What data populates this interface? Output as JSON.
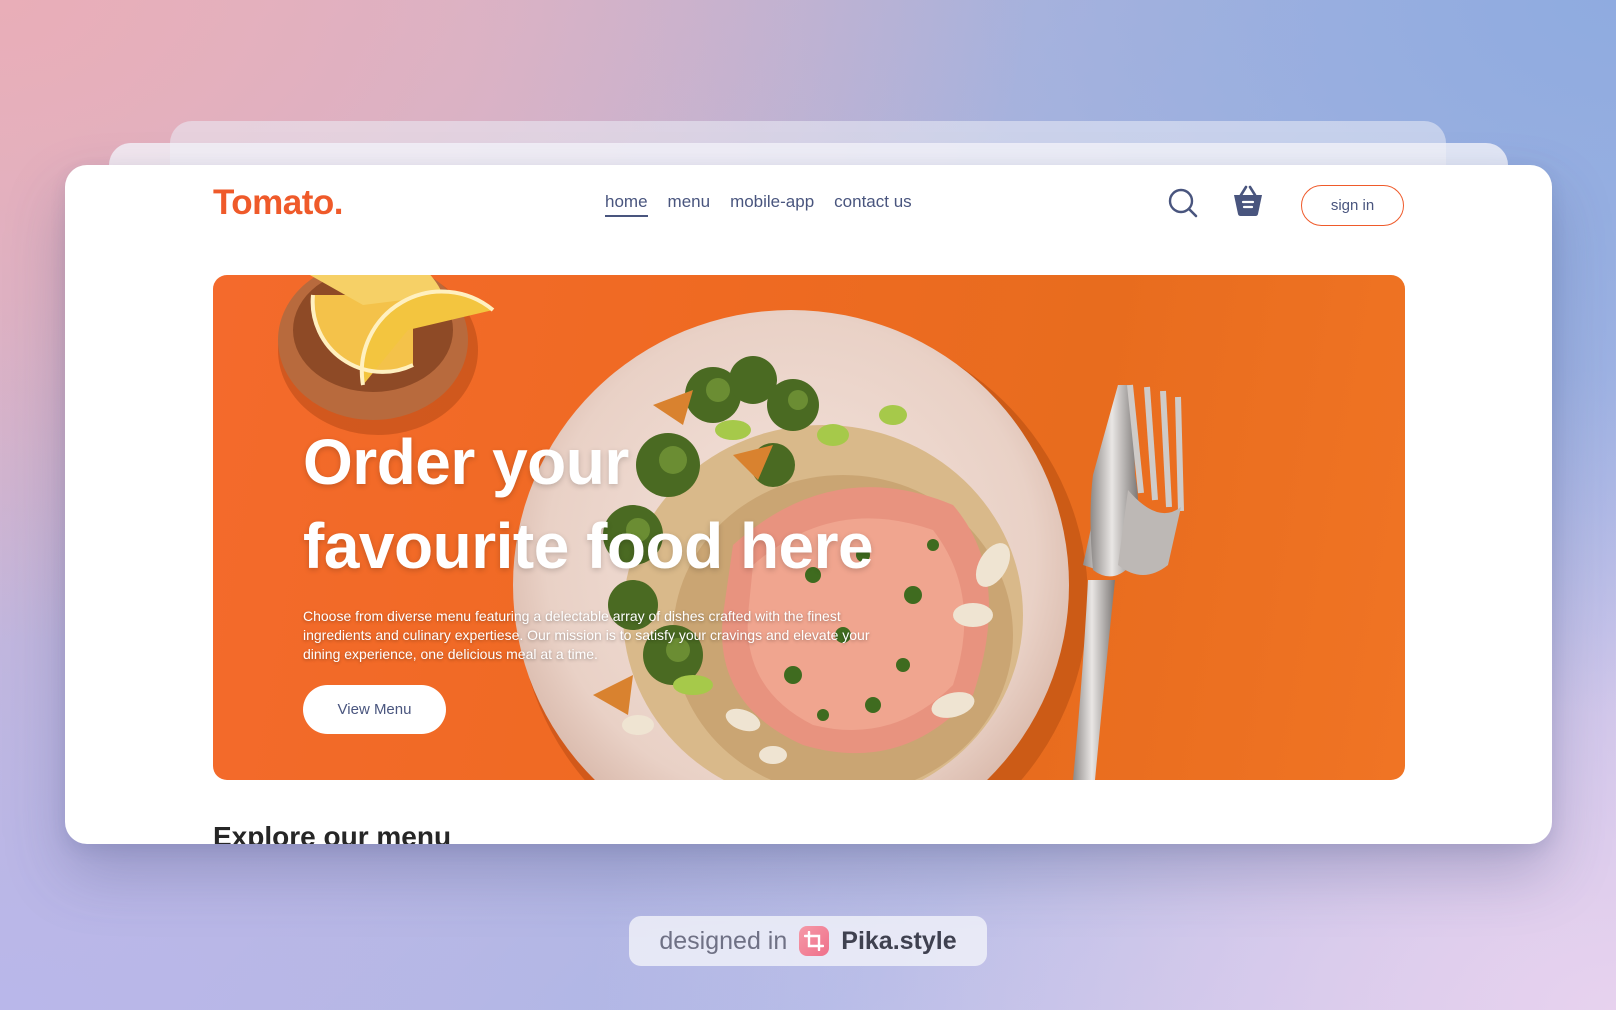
{
  "brand": {
    "logo": "Tomato."
  },
  "nav": {
    "links": [
      {
        "label": "home",
        "active": true
      },
      {
        "label": "menu",
        "active": false
      },
      {
        "label": "mobile-app",
        "active": false
      },
      {
        "label": "contact us",
        "active": false
      }
    ],
    "search_icon": "search-icon",
    "basket_icon": "basket-icon",
    "signin_label": "sign in"
  },
  "hero": {
    "title_line1": "Order your",
    "title_line2": "favourite food here",
    "description": "Choose from diverse menu featuring a delectable array of dishes crafted with the finest ingredients and culinary expertiese. Our mission is to satisfy your cravings and elevate your dining experience, one delicious meal at a time.",
    "button_label": "View Menu"
  },
  "section": {
    "explore_heading": "Explore our menu"
  },
  "watermark": {
    "prefix": "designed in",
    "brand": "Pika.style"
  },
  "colors": {
    "accent": "#ef5a2a",
    "nav_text": "#49557e",
    "hero_bg": "#ef6a22"
  }
}
